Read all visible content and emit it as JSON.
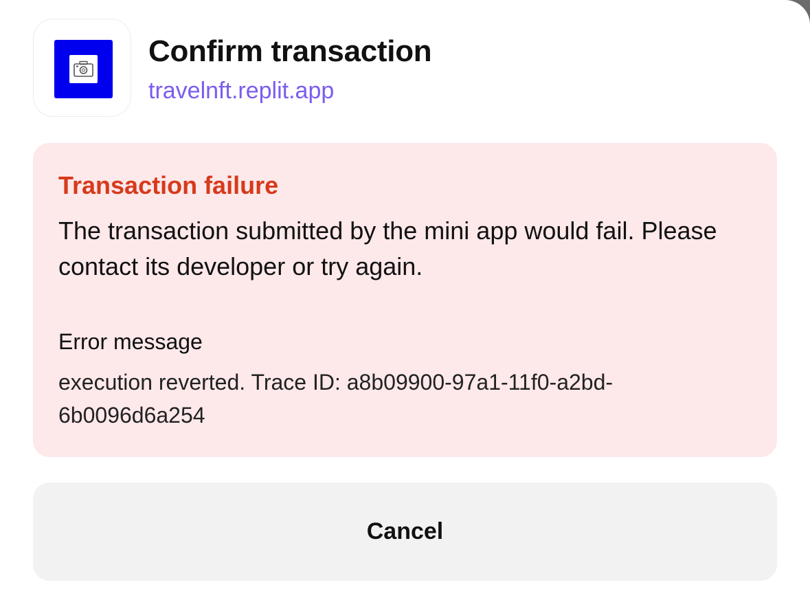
{
  "header": {
    "title": "Confirm transaction",
    "url": "travelnft.replit.app",
    "icon": "camera-icon"
  },
  "error": {
    "title": "Transaction failure",
    "description": "The transaction submitted by the mini app would fail. Please contact its developer or try again.",
    "message_label": "Error message",
    "message_text": "execution reverted. Trace ID: a8b09900-97a1-11f0-a2bd-6b0096d6a254"
  },
  "actions": {
    "cancel_label": "Cancel"
  },
  "colors": {
    "accent": "#7b5cf0",
    "error_title": "#d63a1b",
    "error_background": "#fde8ea",
    "icon_background": "#0000ee"
  }
}
